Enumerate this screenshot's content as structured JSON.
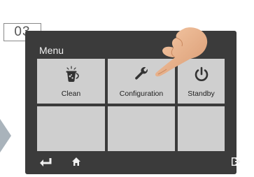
{
  "step": {
    "number": "03"
  },
  "screen": {
    "title": "Menu",
    "tiles": [
      {
        "label": "Clean",
        "icon": "cleaning-cup-icon"
      },
      {
        "label": "Configuration",
        "icon": "wrench-icon"
      },
      {
        "label": "Standby",
        "icon": "power-icon"
      },
      {
        "label": "",
        "icon": ""
      },
      {
        "label": "",
        "icon": ""
      },
      {
        "label": "",
        "icon": ""
      }
    ],
    "bottom_bar": {
      "icons": [
        "back-arrow-icon",
        "home-icon",
        "exit-icon"
      ]
    }
  },
  "colors": {
    "panel": "#3b3b3b",
    "tile": "#cfcfcf",
    "text_light": "#f0f0f0",
    "badge_border": "#8a8a8a",
    "side_arrow": "#a9b3bb"
  }
}
